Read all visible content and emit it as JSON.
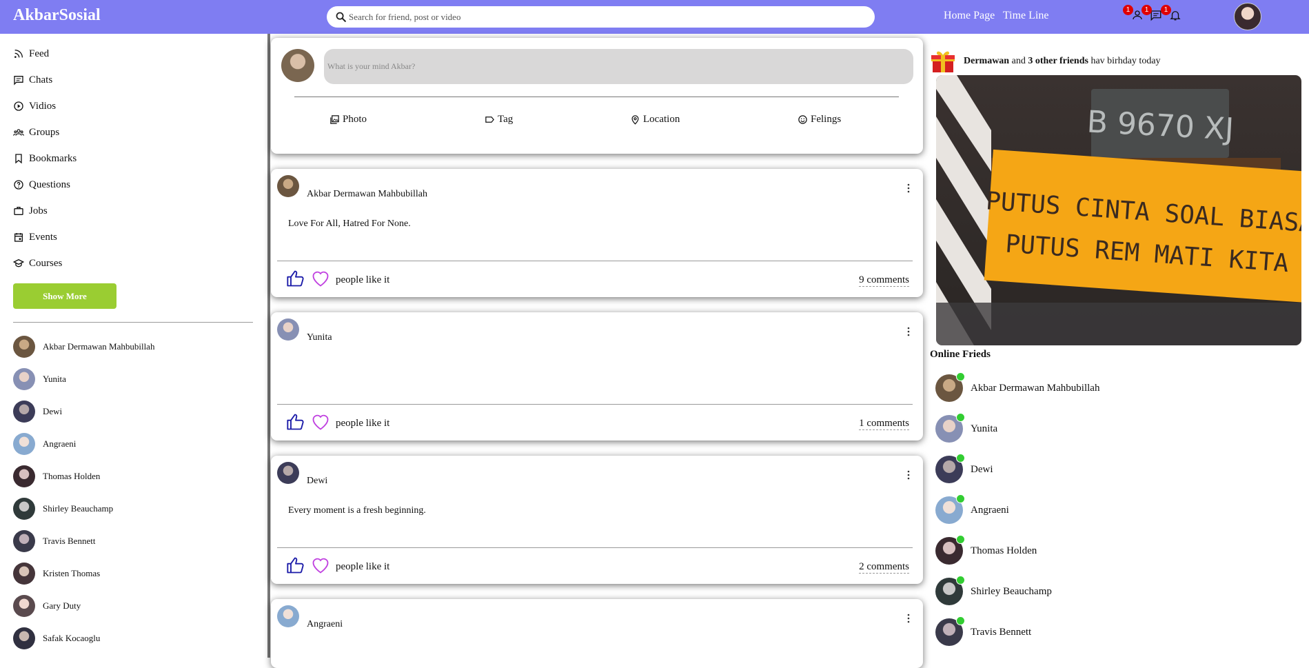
{
  "topbar": {
    "logo": "AkbarSosial",
    "search_placeholder": "Search for friend, post or video",
    "links": [
      "Home Page",
      "Time Line"
    ],
    "badges": {
      "person": "1",
      "chat": "1",
      "notification": "1"
    }
  },
  "sidebar": {
    "items": [
      {
        "label": "Feed",
        "icon": "rss-icon"
      },
      {
        "label": "Chats",
        "icon": "chat-icon"
      },
      {
        "label": "Vidios",
        "icon": "play-circle-icon"
      },
      {
        "label": "Groups",
        "icon": "groups-icon"
      },
      {
        "label": "Bookmarks",
        "icon": "bookmark-icon"
      },
      {
        "label": "Questions",
        "icon": "help-circle-icon"
      },
      {
        "label": "Jobs",
        "icon": "briefcase-icon"
      },
      {
        "label": "Events",
        "icon": "calendar-icon"
      },
      {
        "label": "Courses",
        "icon": "school-icon"
      }
    ],
    "show_more": "Show More",
    "friends": [
      "Akbar Dermawan Mahbubillah",
      "Yunita",
      "Dewi",
      "Angraeni",
      "Thomas Holden",
      "Shirley Beauchamp",
      "Travis Bennett",
      "Kristen Thomas",
      "Gary Duty",
      "Safak Kocaoglu"
    ]
  },
  "share": {
    "placeholder": "What is your mind Akbar?",
    "options": [
      "Photo",
      "Tag",
      "Location",
      "Felings"
    ]
  },
  "posts": [
    {
      "name": "Akbar Dermawan Mahbubillah",
      "text": "Love For All, Hatred For None.",
      "likes": "people like it",
      "comments": "9 comments"
    },
    {
      "name": "Yunita",
      "text": "",
      "likes": "people like it",
      "comments": "1 comments"
    },
    {
      "name": "Dewi",
      "text": "Every moment is a fresh beginning.",
      "likes": "people like it",
      "comments": "2 comments"
    },
    {
      "name": "Angraeni"
    }
  ],
  "rightbar": {
    "birthday": {
      "name": "Dermawan",
      "mid": " and ",
      "others": "3 other friends",
      "rest": " hav birhday today"
    },
    "ad_image": {
      "plate": "B 9670 XJ",
      "line1": "PUTUS CINTA SOAL BIASA",
      "line2": "PUTUS REM MATI KITA"
    },
    "online_title": "Online Frieds",
    "online": [
      "Akbar Dermawan Mahbubillah",
      "Yunita",
      "Dewi",
      "Angraeni",
      "Thomas Holden",
      "Shirley Beauchamp",
      "Travis Bennett"
    ]
  },
  "colors": {
    "topbar": "#7f7df2",
    "show_more": "#9acd32",
    "online_dot": "#32cd32",
    "badge": "#e00000",
    "like": "#1a1aa8",
    "heart": "#c040e0"
  }
}
